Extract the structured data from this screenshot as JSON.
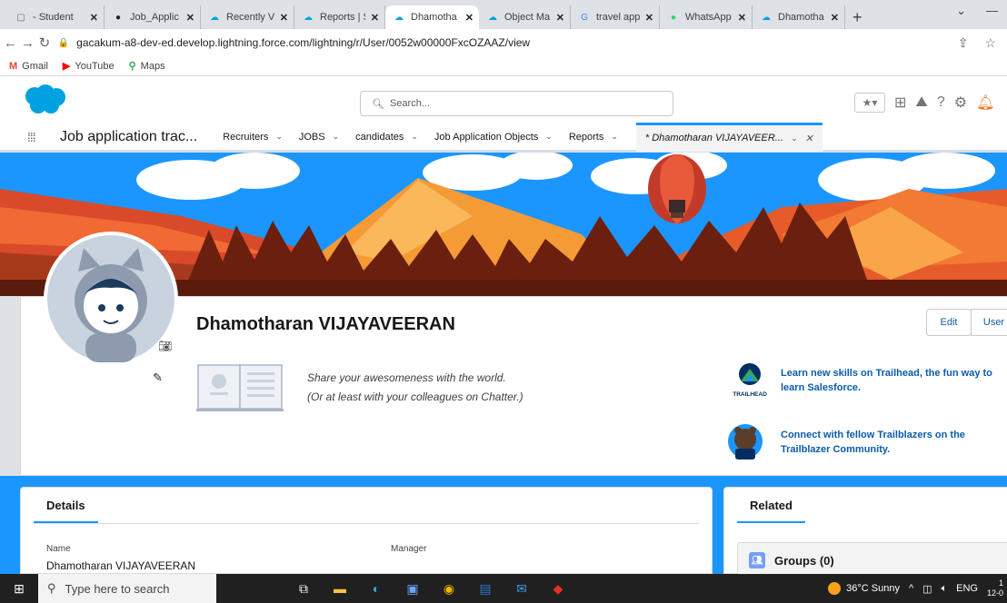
{
  "browser": {
    "tabs": [
      {
        "title": "- Student",
        "icon": "page-icon",
        "color": "#5f6368",
        "active": false
      },
      {
        "title": "Job_Applic",
        "icon": "github-icon",
        "color": "#202124",
        "active": false
      },
      {
        "title": "Recently V",
        "icon": "salesforce-icon",
        "color": "#00a1e0",
        "active": false
      },
      {
        "title": "Reports | S",
        "icon": "salesforce-icon",
        "color": "#00a1e0",
        "active": false
      },
      {
        "title": "Dhamotha",
        "icon": "salesforce-icon",
        "color": "#00a1e0",
        "active": true
      },
      {
        "title": "Object Ma",
        "icon": "salesforce-icon",
        "color": "#00a1e0",
        "active": false
      },
      {
        "title": "travel appr",
        "icon": "google-icon",
        "color": "#4285f4",
        "active": false
      },
      {
        "title": "WhatsApp",
        "icon": "whatsapp-icon",
        "color": "#25d366",
        "active": false
      },
      {
        "title": "Dhamotha",
        "icon": "salesforce-icon",
        "color": "#00a1e0",
        "active": false
      }
    ],
    "new_tab": "+",
    "url": "gacakum-a8-dev-ed.develop.lightning.force.com/lightning/r/User/0052w00000FxcOZAAZ/view",
    "bookmarks": [
      {
        "label": "Gmail",
        "icon": "gmail-icon",
        "color": "#ea4335",
        "glyph": "M"
      },
      {
        "label": "YouTube",
        "icon": "youtube-icon",
        "color": "#ff0000",
        "glyph": "▶"
      },
      {
        "label": "Maps",
        "icon": "maps-icon",
        "color": "#34a853",
        "glyph": "⚲"
      }
    ]
  },
  "header": {
    "search_placeholder": "Search..."
  },
  "nav": {
    "app_name": "Job application trac...",
    "items": [
      {
        "label": "Recruiters"
      },
      {
        "label": "JOBS"
      },
      {
        "label": "candidates"
      },
      {
        "label": "Job Application Objects"
      },
      {
        "label": "Reports"
      }
    ],
    "active_tab": "* Dhamotharan VIJAYAVEER..."
  },
  "profile": {
    "name": "Dhamotharan VIJAYAVEERAN",
    "edit_button": "Edit",
    "user_button": "User",
    "chatter_line1": "Share your awesomeness with the world.",
    "chatter_line2": "(Or at least with your colleagues on Chatter.)",
    "trailhead_label": "TRAILHEAD",
    "trailhead_text": "Learn new skills on Trailhead, the fun way to learn Salesforce.",
    "trailblazer_text": "Connect with fellow Trailblazers on the Trailblazer Community."
  },
  "details": {
    "tab": "Details",
    "name_label": "Name",
    "name_value": "Dhamotharan VIJAYAVEERAN",
    "manager_label": "Manager"
  },
  "related": {
    "tab": "Related",
    "groups": "Groups (0)"
  },
  "taskbar": {
    "search_placeholder": "Type here to search",
    "weather": "36°C Sunny",
    "lang": "ENG",
    "clock_top": "1",
    "clock_bottom": "12-0"
  },
  "colors": {
    "brand": "#1b96ff",
    "link": "#0b5cab"
  }
}
